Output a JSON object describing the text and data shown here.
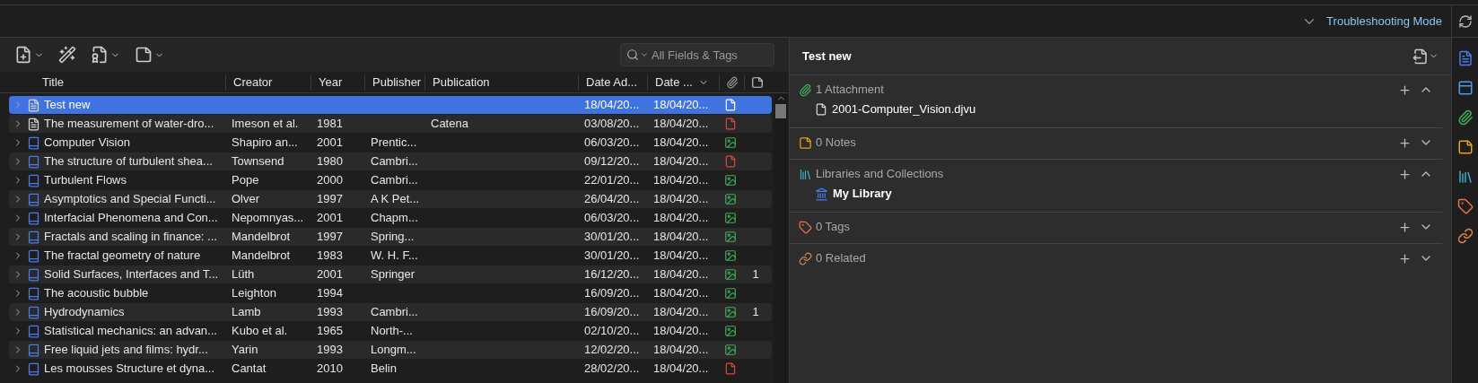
{
  "top_bar": {
    "mode_label": "Troubleshooting Mode"
  },
  "toolbar": {
    "search": {
      "placeholder": "All Fields & Tags"
    }
  },
  "table": {
    "columns": [
      "Title",
      "Creator",
      "Year",
      "Publisher",
      "Publication",
      "Date Ad...",
      "Date ..."
    ],
    "rows": [
      {
        "kind": "document",
        "title": "Test new",
        "date_added": "18/04/20...",
        "date_modified": "18/04/20...",
        "attachment": {
          "kind": "file"
        },
        "selected": true
      },
      {
        "kind": "document",
        "title": "The measurement of water-dro...",
        "creator": "Imeson et al.",
        "year": "1981",
        "publication": "Catena",
        "date_added": "03/08/20...",
        "date_modified": "18/04/20...",
        "attachment": {
          "kind": "pdf"
        },
        "selected": false
      },
      {
        "kind": "book",
        "title": "Computer Vision",
        "creator": "Shapiro an...",
        "year": "2001",
        "publisher": "Prentic...",
        "date_added": "06/03/20...",
        "date_modified": "18/04/20...",
        "attachment": {
          "kind": "image"
        },
        "selected": false
      },
      {
        "kind": "book",
        "title": "The structure of turbulent shea...",
        "creator": "Townsend",
        "year": "1980",
        "publisher": "Cambri...",
        "date_added": "09/12/20...",
        "date_modified": "18/04/20...",
        "attachment": {
          "kind": "pdf"
        },
        "selected": false
      },
      {
        "kind": "book",
        "title": "Turbulent Flows",
        "creator": "Pope",
        "year": "2000",
        "publisher": "Cambri...",
        "date_added": "22/01/20...",
        "date_modified": "18/04/20...",
        "attachment": {
          "kind": "image"
        },
        "selected": false
      },
      {
        "kind": "book",
        "title": "Asymptotics and Special Functi...",
        "creator": "Olver",
        "year": "1997",
        "publisher": "A K Pet...",
        "date_added": "26/04/20...",
        "date_modified": "18/04/20...",
        "attachment": {
          "kind": "image"
        },
        "selected": false
      },
      {
        "kind": "book",
        "title": "Interfacial Phenomena and Con...",
        "creator": "Nepomnyas...",
        "year": "2001",
        "publisher": "Chapm...",
        "date_added": "06/03/20...",
        "date_modified": "18/04/20...",
        "attachment": {
          "kind": "image"
        },
        "selected": false
      },
      {
        "kind": "book",
        "title": "Fractals and scaling in finance: ...",
        "creator": "Mandelbrot",
        "year": "1997",
        "publisher": "Spring...",
        "date_added": "30/01/20...",
        "date_modified": "18/04/20...",
        "attachment": {
          "kind": "image"
        },
        "selected": false
      },
      {
        "kind": "book",
        "title": "The fractal geometry of nature",
        "creator": "Mandelbrot",
        "year": "1983",
        "publisher": "W. H. F...",
        "date_added": "30/01/20...",
        "date_modified": "18/04/20...",
        "attachment": {
          "kind": "image"
        },
        "selected": false
      },
      {
        "kind": "book",
        "title": "Solid Surfaces, Interfaces and T...",
        "creator": "Lüth",
        "year": "2001",
        "publisher": "Springer",
        "date_added": "16/12/20...",
        "date_modified": "18/04/20...",
        "attachment": {
          "kind": "image"
        },
        "notes": "1",
        "selected": false
      },
      {
        "kind": "book",
        "title": "The acoustic bubble",
        "creator": "Leighton",
        "year": "1994",
        "date_added": "16/09/20...",
        "date_modified": "18/04/20...",
        "attachment": {
          "kind": "image"
        },
        "selected": false
      },
      {
        "kind": "book",
        "title": "Hydrodynamics",
        "creator": "Lamb",
        "year": "1993",
        "publisher": "Cambri...",
        "date_added": "16/09/20...",
        "date_modified": "18/04/20...",
        "attachment": {
          "kind": "image"
        },
        "notes": "1",
        "selected": false
      },
      {
        "kind": "book",
        "title": "Statistical mechanics: an advan...",
        "creator": "Kubo et al.",
        "year": "1965",
        "publisher": "North-...",
        "date_added": "02/10/20...",
        "date_modified": "18/04/20...",
        "attachment": {
          "kind": "image"
        },
        "selected": false
      },
      {
        "kind": "book",
        "title": "Free liquid jets and films: hydr...",
        "creator": "Yarin",
        "year": "1993",
        "publisher": "Longm...",
        "date_added": "12/02/20...",
        "date_modified": "18/04/20...",
        "attachment": {
          "kind": "image"
        },
        "selected": false
      },
      {
        "kind": "book",
        "title": "Les mousses Structure et dyna...",
        "creator": "Cantat",
        "year": "2010",
        "publisher": "Belin",
        "date_added": "28/02/20...",
        "date_modified": "18/04/20...",
        "attachment": {
          "kind": "pdf"
        },
        "selected": false
      }
    ]
  },
  "item_pane": {
    "title": "Test new",
    "sections": [
      {
        "kind": "attachments",
        "label": "1 Attachment",
        "expanded": true,
        "items": [
          "2001-Computer_Vision.djvu"
        ]
      },
      {
        "kind": "notes",
        "label": "0 Notes",
        "expanded": false
      },
      {
        "kind": "libraries",
        "label": "Libraries and Collections",
        "expanded": true,
        "items": [
          "My Library"
        ]
      },
      {
        "kind": "tags",
        "label": "0 Tags",
        "expanded": false
      },
      {
        "kind": "related",
        "label": "0 Related",
        "expanded": false
      }
    ]
  }
}
